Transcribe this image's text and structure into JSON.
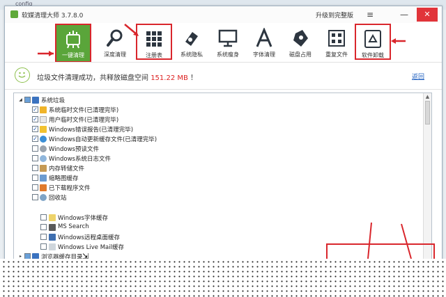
{
  "background": {
    "crumb": "config"
  },
  "window": {
    "title": "软媒清理大师 3.7.8.0",
    "upgrade_label": "升级到完整版",
    "menu_glyph": "≡",
    "minimize_glyph": "—",
    "close_glyph": "✕"
  },
  "toolbar": {
    "items": [
      {
        "label": "一键清理",
        "icon": "broom-icon"
      },
      {
        "label": "深度清理",
        "icon": "magnifier-icon"
      },
      {
        "label": "注册表",
        "icon": "grid-icon"
      },
      {
        "label": "系统隐私",
        "icon": "eraser-icon"
      },
      {
        "label": "系统瘦身",
        "icon": "monitor-icon"
      },
      {
        "label": "字体清理",
        "icon": "letter-a-icon"
      },
      {
        "label": "磁盘占用",
        "icon": "disk-icon"
      },
      {
        "label": "重复文件",
        "icon": "duplicate-icon"
      },
      {
        "label": "软件卸载",
        "icon": "recycle-icon"
      }
    ]
  },
  "status": {
    "prefix": "垃圾文件清理成功，共释放磁盘空间 ",
    "size": "151.22 MB",
    "suffix": " ！",
    "link": "返回"
  },
  "tree": {
    "root": "系统垃圾",
    "items": [
      {
        "label": "系统临时文件(已清理完毕)",
        "checked": true,
        "color": "#f0b429"
      },
      {
        "label": "用户临时文件(已清理完毕)",
        "checked": true,
        "color": "#e8e8e8"
      },
      {
        "label": "Windows错误报告(已清理完毕)",
        "checked": true,
        "color": "#f2c230"
      },
      {
        "label": "Windows自动更新缓存文件(已清理完毕)",
        "checked": true,
        "color": "#3b8fd6"
      },
      {
        "label": "Windows预读文件",
        "checked": false,
        "color": "#9aa3ad"
      },
      {
        "label": "Windows系统日志文件",
        "checked": false,
        "color": "#8fb6dc"
      },
      {
        "label": "内存转储文件",
        "checked": false,
        "color": "#c59a55"
      },
      {
        "label": "缩略图缓存",
        "checked": false,
        "color": "#6b9bd0"
      },
      {
        "label": "已下载程序文件",
        "checked": false,
        "color": "#e07a2c"
      },
      {
        "label": "回收站",
        "checked": false,
        "color": "#7fa4c6"
      }
    ],
    "items2": [
      {
        "label": "Windows字体缓存",
        "checked": false,
        "color": "#eed36a"
      },
      {
        "label": "MS Search",
        "checked": false,
        "color": "#5a5a5a"
      },
      {
        "label": "Windows远程桌面缓存",
        "checked": false,
        "color": "#3f6fb0"
      },
      {
        "label": "Windows Live Mail缓存",
        "checked": false,
        "color": "#cfd6dc"
      }
    ],
    "root2": "浏览器缓存目录"
  },
  "colors": {
    "accent": "#5aa53a",
    "annotation": "#d9262c",
    "highlight": "#d22222"
  }
}
